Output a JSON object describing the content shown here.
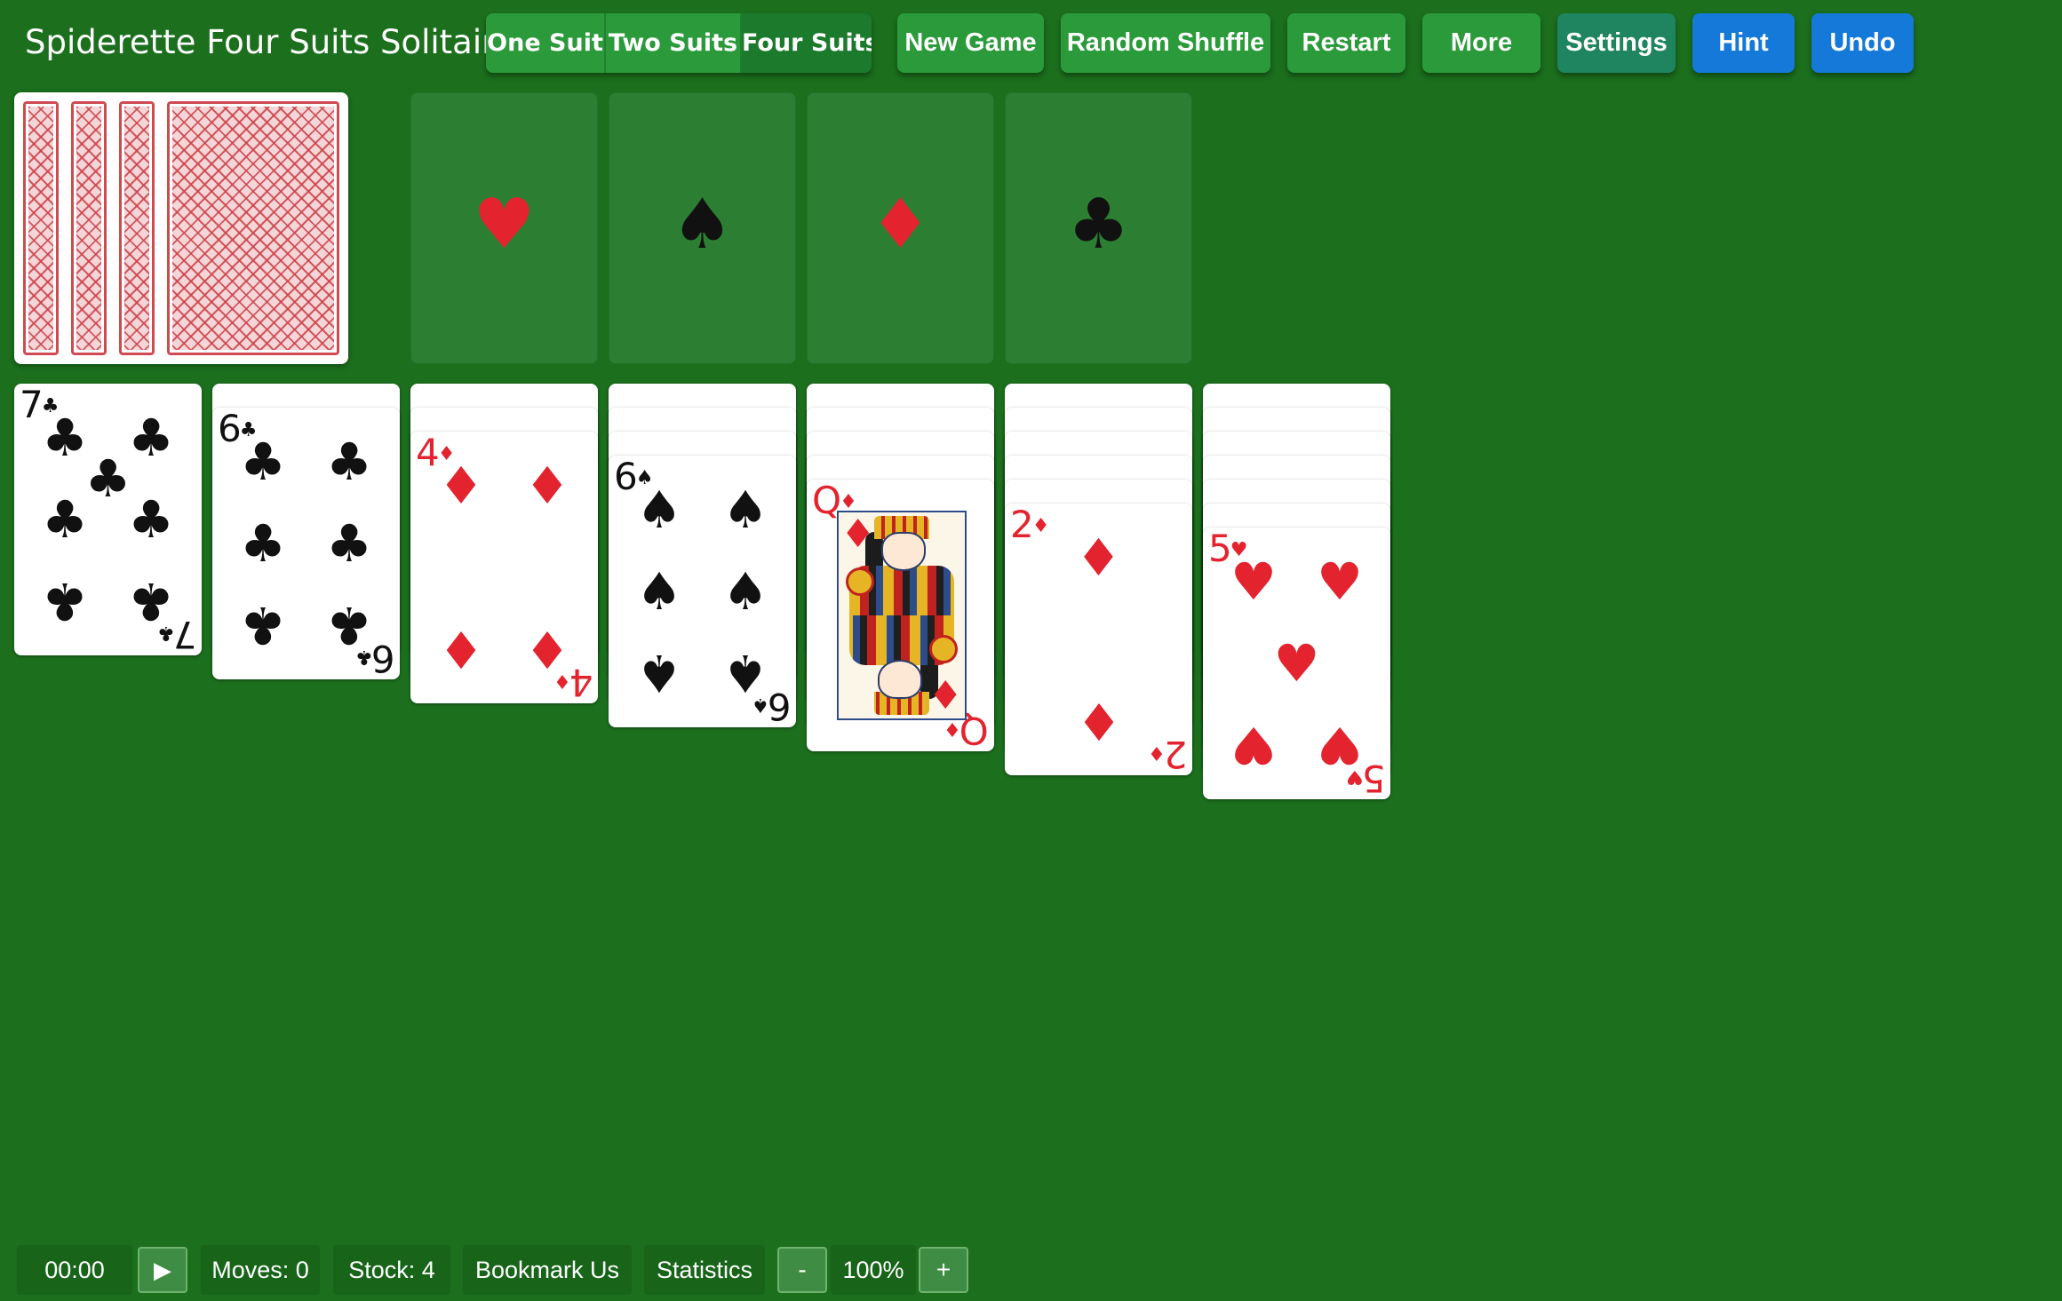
{
  "header": {
    "title": "Spiderette Four Suits Solitaire",
    "modes": [
      "One Suit",
      "Two Suits",
      "Four Suits"
    ],
    "active_mode": "Four Suits",
    "buttons": {
      "new_game": "New Game",
      "random_shuffle": "Random Shuffle",
      "restart": "Restart",
      "more": "More",
      "settings": "Settings",
      "hint": "Hint",
      "undo": "Undo"
    }
  },
  "foundations": [
    {
      "suit": "hearts",
      "symbol": "♥",
      "color": "#e3232e"
    },
    {
      "suit": "spades",
      "symbol": "♠",
      "color": "#111111"
    },
    {
      "suit": "diamonds",
      "symbol": "♦",
      "color": "#e3232e"
    },
    {
      "suit": "clubs",
      "symbol": "♣",
      "color": "#111111"
    }
  ],
  "stock_piles_visible": 4,
  "tableau": [
    {
      "hidden": 0,
      "top": {
        "rank": "7",
        "suit": "♣",
        "color": "black"
      }
    },
    {
      "hidden": 1,
      "top": {
        "rank": "6",
        "suit": "♣",
        "color": "black"
      }
    },
    {
      "hidden": 2,
      "top": {
        "rank": "4",
        "suit": "♦",
        "color": "red"
      }
    },
    {
      "hidden": 3,
      "top": {
        "rank": "6",
        "suit": "♠",
        "color": "black"
      }
    },
    {
      "hidden": 4,
      "top": {
        "rank": "Q",
        "suit": "♦",
        "color": "red"
      }
    },
    {
      "hidden": 5,
      "top": {
        "rank": "2",
        "suit": "♦",
        "color": "red"
      }
    },
    {
      "hidden": 6,
      "top": {
        "rank": "5",
        "suit": "♥",
        "color": "red"
      }
    }
  ],
  "footer": {
    "timer": "00:00",
    "play_icon": "play-icon",
    "moves": "Moves: 0",
    "stock": "Stock: 4",
    "bookmark": "Bookmark Us",
    "statistics": "Statistics",
    "zoom_out": "-",
    "zoom": "100%",
    "zoom_in": "+"
  },
  "colors": {
    "table": "#1b6f1d",
    "button_green": "#2b9a3a",
    "button_teal": "#1f8460",
    "button_blue": "#1479d9",
    "red_suit": "#e3232e",
    "black_suit": "#111111"
  }
}
